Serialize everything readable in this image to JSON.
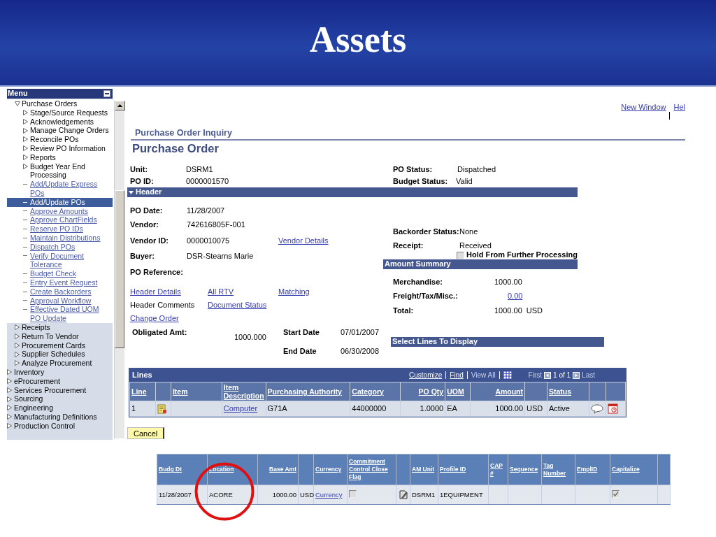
{
  "slide": {
    "title": "Assets"
  },
  "menu": {
    "title": "Menu",
    "items": [
      {
        "label": "Purchase Orders",
        "kind": "folder",
        "expanded": true,
        "selected": false,
        "children": [
          {
            "label": "Stage/Source Requests",
            "kind": "folder",
            "expanded": false,
            "selected": false
          },
          {
            "label": "Acknowledgements",
            "kind": "folder",
            "expanded": false,
            "selected": false
          },
          {
            "label": "Manage Change Orders",
            "kind": "folder",
            "expanded": false,
            "selected": false
          },
          {
            "label": "Reconcile POs",
            "kind": "folder",
            "expanded": false,
            "selected": false
          },
          {
            "label": "Review PO Information",
            "kind": "folder",
            "expanded": false,
            "selected": false
          },
          {
            "label": "Reports",
            "kind": "folder",
            "expanded": false,
            "selected": false
          },
          {
            "label": "Budget Year End Processing",
            "kind": "folder",
            "expanded": false,
            "selected": false
          },
          {
            "label": "Add/Update Express POs",
            "kind": "link",
            "selected": false
          },
          {
            "label": "Add/Update POs",
            "kind": "link",
            "selected": true
          },
          {
            "label": "Approve Amounts",
            "kind": "link",
            "selected": false
          },
          {
            "label": "Approve ChartFields",
            "kind": "link",
            "selected": false
          },
          {
            "label": "Reserve PO IDs",
            "kind": "link",
            "selected": false
          },
          {
            "label": "Maintain Distributions",
            "kind": "link",
            "selected": false
          },
          {
            "label": "Dispatch POs",
            "kind": "link",
            "selected": false
          },
          {
            "label": "Verify Document Tolerance",
            "kind": "link",
            "selected": false
          },
          {
            "label": "Budget Check",
            "kind": "link",
            "selected": false
          },
          {
            "label": "Entry Event Request",
            "kind": "link",
            "selected": false
          },
          {
            "label": "Create Backorders",
            "kind": "link",
            "selected": false
          },
          {
            "label": "Approval Workflow",
            "kind": "link",
            "selected": false
          },
          {
            "label": "Effective Dated UOM PO Update",
            "kind": "link",
            "selected": false
          }
        ]
      },
      {
        "label": "Receipts",
        "kind": "folder",
        "expanded": false,
        "selected": false
      },
      {
        "label": "Return To Vendor",
        "kind": "folder",
        "expanded": false,
        "selected": false
      },
      {
        "label": "Procurement Cards",
        "kind": "folder",
        "expanded": false,
        "selected": false
      },
      {
        "label": "Supplier Schedules",
        "kind": "folder",
        "expanded": false,
        "selected": false
      },
      {
        "label": "Analyze Procurement",
        "kind": "folder",
        "expanded": false,
        "selected": false
      }
    ],
    "top_items": [
      {
        "label": "Inventory",
        "kind": "folder",
        "expanded": false,
        "selected": false
      },
      {
        "label": "eProcurement",
        "kind": "folder",
        "expanded": false,
        "selected": false
      },
      {
        "label": "Services Procurement",
        "kind": "folder",
        "expanded": false,
        "selected": false
      },
      {
        "label": "Sourcing",
        "kind": "folder",
        "expanded": false,
        "selected": false
      },
      {
        "label": "Engineering",
        "kind": "folder",
        "expanded": false,
        "selected": false
      },
      {
        "label": "Manufacturing Definitions",
        "kind": "folder",
        "expanded": false,
        "selected": false
      },
      {
        "label": "Production Control",
        "kind": "folder",
        "expanded": false,
        "selected": false
      }
    ]
  },
  "top_links": [
    "New Window",
    "Hel"
  ],
  "page": {
    "breadcrumb": "Purchase Order Inquiry",
    "title": "Purchase Order"
  },
  "summary": {
    "left": [
      {
        "label": "Unit:",
        "value": "DSRM1"
      },
      {
        "label": "PO ID:",
        "value": "0000001570"
      }
    ],
    "right": [
      {
        "label": "PO Status:",
        "value": "Dispatched"
      },
      {
        "label": "Budget Status:",
        "value": "Valid"
      }
    ]
  },
  "header_section": {
    "title": "Header",
    "expanded": true,
    "fields": [
      {
        "label": "PO Date:",
        "value": "11/28/2007"
      },
      {
        "label": "Vendor:",
        "value": "742616805F-001"
      },
      {
        "label": "Vendor ID:",
        "value": "0000010075",
        "link": "Vendor Details"
      },
      {
        "label": "Buyer:",
        "value": "DSR-Stearns Marie"
      },
      {
        "label": "PO Reference:"
      }
    ],
    "links": [
      [
        {
          "label": "Header Details",
          "kind": "link"
        },
        {
          "label": "All RTV",
          "kind": "link"
        },
        {
          "label": "Matching",
          "kind": "link"
        }
      ],
      [
        {
          "label": "Header Comments",
          "kind": "text"
        },
        {
          "label": "Document Status",
          "kind": "link"
        }
      ],
      [
        {
          "label": "Change Order",
          "kind": "link"
        }
      ]
    ],
    "obligated": {
      "label": "Obligated Amt:",
      "value": "1000.000"
    },
    "dates": [
      {
        "label": "Start Date",
        "value": "07/01/2007"
      },
      {
        "label": "End Date",
        "value": "06/30/2008"
      }
    ],
    "status_fields": [
      {
        "label": "Backorder Status:",
        "value": "None"
      },
      {
        "label": "Receipt:",
        "value": "Received"
      }
    ],
    "hold": {
      "label": "Hold From Further Processing",
      "checked": false
    },
    "amount_summary": {
      "title": "Amount Summary",
      "rows": [
        {
          "label": "Merchandise:",
          "value": "1000.00",
          "kind": "text"
        },
        {
          "label": "Freight/Tax/Misc.:",
          "value": "0.00",
          "kind": "link"
        },
        {
          "label": "Total:",
          "value": "1000.00",
          "currency": "USD",
          "kind": "text"
        }
      ]
    },
    "select_lines": {
      "title": "Select Lines To Display"
    }
  },
  "lines": {
    "title": "Lines",
    "nav": [
      "Customize",
      "Find",
      "View All"
    ],
    "pager": {
      "first": "First",
      "position": "1 of 1",
      "last": "Last"
    },
    "columns": [
      {
        "label": "Line"
      },
      {},
      {
        "label": "Item"
      },
      {
        "label": "Item Description"
      },
      {
        "label": "Purchasing Authority"
      },
      {
        "label": "Category"
      },
      {
        "label": "PO Qty"
      },
      {
        "label": "UOM"
      },
      {
        "label": "Amount"
      },
      {},
      {
        "label": "Status"
      },
      {},
      {}
    ],
    "rows": [
      {
        "cells": [
          {
            "kind": "text",
            "text": "1"
          },
          {
            "kind": "doc_icon"
          },
          {
            "kind": "empty"
          },
          {
            "kind": "link",
            "text": "Computer"
          },
          {
            "kind": "text",
            "text": "G71A"
          },
          {
            "kind": "text",
            "text": "44000000"
          },
          {
            "kind": "text",
            "text": "1.0000"
          },
          {
            "kind": "text",
            "text": "EA"
          },
          {
            "kind": "text",
            "text": "1000.00"
          },
          {
            "kind": "text",
            "text": "USD"
          },
          {
            "kind": "text",
            "text": "Active"
          },
          {
            "kind": "comment_icon"
          },
          {
            "kind": "calendar_icon"
          }
        ]
      }
    ]
  },
  "cancel_button": {
    "label": "Cancel"
  },
  "distribution": {
    "columns": [
      {
        "label": "Budg Dt"
      },
      {
        "label": "Location"
      },
      {
        "label": "Base Amt"
      },
      {},
      {
        "label": "Currency"
      },
      {
        "label": "Commitment Control Close Flag"
      },
      {},
      {
        "label": "AM Unit"
      },
      {
        "label": "Profile ID"
      },
      {
        "label": "CAP #"
      },
      {
        "label": "Sequence"
      },
      {
        "label": "Tag Number"
      },
      {
        "label": "EmplID"
      },
      {
        "label": "Capitalize"
      },
      {}
    ],
    "rows": [
      {
        "cells": [
          {
            "kind": "text",
            "text": "11/28/2007"
          },
          {
            "kind": "text",
            "text": "ACORE"
          },
          {
            "kind": "text",
            "text": "1000.00"
          },
          {
            "kind": "text",
            "text": "USD"
          },
          {
            "kind": "link",
            "text": "Currency"
          },
          {
            "kind": "checkbox",
            "checked": false
          },
          {
            "kind": "edit_icon"
          },
          {
            "kind": "text",
            "text": "DSRM1"
          },
          {
            "kind": "text",
            "text": "1EQUIPMENT"
          },
          {
            "kind": "empty"
          },
          {
            "kind": "empty"
          },
          {
            "kind": "empty"
          },
          {
            "kind": "empty"
          },
          {
            "kind": "checkbox",
            "checked": true
          },
          {
            "kind": "empty"
          }
        ]
      }
    ]
  }
}
